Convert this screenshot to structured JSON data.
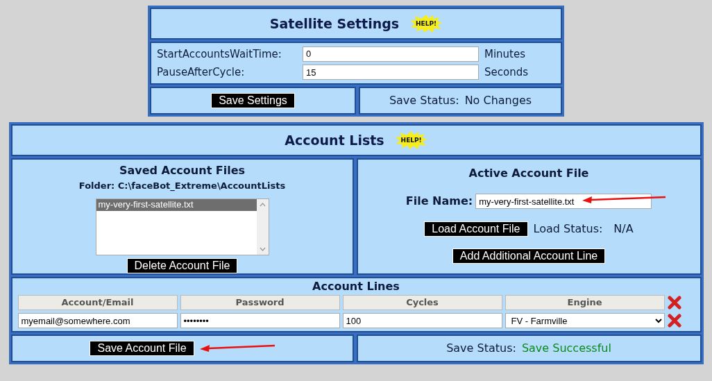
{
  "satellite_settings": {
    "title": "Satellite Settings",
    "help": "HELP!",
    "fields": [
      {
        "label": "StartAccountsWaitTime:",
        "value": "0",
        "unit": "Minutes"
      },
      {
        "label": "PauseAfterCycle:",
        "value": "15",
        "unit": "Seconds"
      }
    ],
    "save_button": "Save Settings",
    "status_label": "Save Status:",
    "status": {
      "text": "No Changes",
      "color": "#0d1a3a"
    }
  },
  "account_lists": {
    "title": "Account Lists",
    "help": "HELP!",
    "saved_files": {
      "title": "Saved Account Files",
      "folder": "Folder: C:\\faceBot_Extreme\\AccountLists",
      "files": [
        {
          "name": "my-very-first-satellite.txt",
          "selected": true
        }
      ],
      "delete_button": "Delete Account File"
    },
    "active_file": {
      "title": "Active Account File",
      "file_label": "File Name:",
      "file_name": "my-very-first-satellite.txt",
      "load_button": "Load Account File",
      "load_status_label": "Load Status:",
      "load_status": "N/A",
      "add_button": "Add Additional Account Line"
    },
    "account_lines": {
      "title": "Account Lines",
      "columns": [
        "Account/Email",
        "Password",
        "Cycles",
        "Engine"
      ],
      "rows": [
        {
          "email": "myemail@somewhere.com",
          "password": "••••••••",
          "cycles": "100",
          "engine": "FV - Farmville"
        }
      ]
    },
    "save_button": "Save Account File",
    "status_label": "Save Status:",
    "status": {
      "text": "Save Successful",
      "color": "#0a8a1a"
    }
  }
}
